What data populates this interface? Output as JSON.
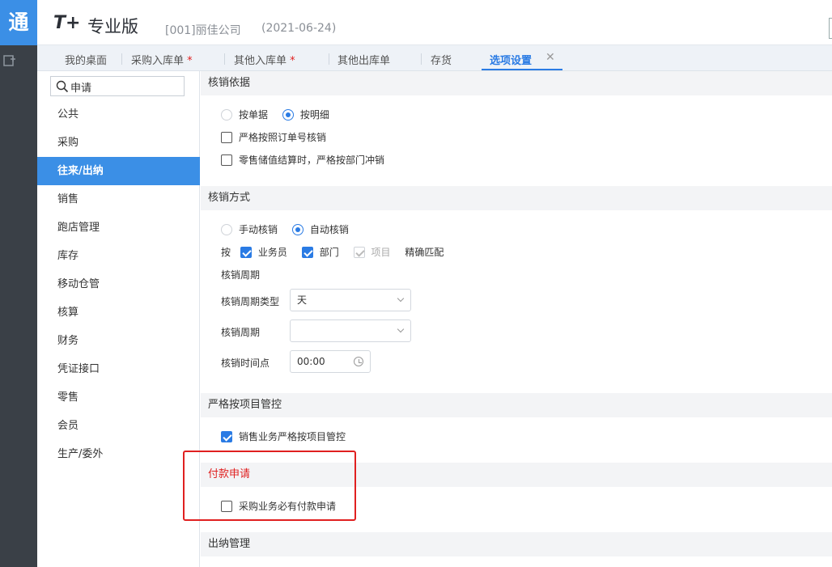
{
  "app": {
    "logo_text": "通",
    "brand": "T+",
    "edition": "专业版",
    "company": "[001]丽佳公司",
    "date": "(2021-06-24)"
  },
  "tabs": [
    {
      "label": "我的桌面",
      "modified": false
    },
    {
      "label": "采购入库单",
      "modified": true
    },
    {
      "label": "其他入库单",
      "modified": true
    },
    {
      "label": "其他出库单",
      "modified": false
    },
    {
      "label": "存货",
      "modified": false
    },
    {
      "label": "选项设置",
      "modified": false,
      "active": true
    }
  ],
  "modified_mark": "*",
  "search": {
    "value": "申请"
  },
  "sidebar": {
    "items": [
      "公共",
      "采购",
      "往来/出纳",
      "销售",
      "跑店管理",
      "库存",
      "移动仓管",
      "核算",
      "财务",
      "凭证接口",
      "零售",
      "会员",
      "生产/委外"
    ],
    "active_index": 2
  },
  "sections": {
    "basis": {
      "title": "核销依据",
      "radio_by_doc": "按单据",
      "radio_by_detail": "按明细",
      "radio_selected": "按明细",
      "cb_order_no": {
        "label": "严格按照订单号核销",
        "checked": false
      },
      "cb_retail": {
        "label": "零售储值结算时，严格按部门冲销",
        "checked": false
      }
    },
    "method": {
      "title": "核销方式",
      "radio_manual": "手动核销",
      "radio_auto": "自动核销",
      "radio_selected": "自动核销",
      "by_label": "按",
      "cb_salesman": {
        "label": "业务员",
        "checked": true
      },
      "cb_dept": {
        "label": "部门",
        "checked": true
      },
      "cb_project": {
        "label": "项目",
        "checked": true,
        "disabled": true
      },
      "exact_match": "精确匹配",
      "period_heading": "核销周期",
      "period_type_label": "核销周期类型",
      "period_type_value": "天",
      "period_label": "核销周期",
      "period_value": "",
      "time_label": "核销时间点",
      "time_value": "00:00"
    },
    "project_ctrl": {
      "title": "严格按项目管控",
      "cb_sales_project": {
        "label": "销售业务严格按项目管控",
        "checked": true
      }
    },
    "payment_request": {
      "title": "付款申请",
      "cb_purchase_required": {
        "label": "采购业务必有付款申请",
        "checked": false
      }
    },
    "cashier": {
      "title": "出纳管理"
    }
  },
  "colors": {
    "accent": "#3b8fe6",
    "alert": "#e02020",
    "rail": "#3a4047"
  }
}
